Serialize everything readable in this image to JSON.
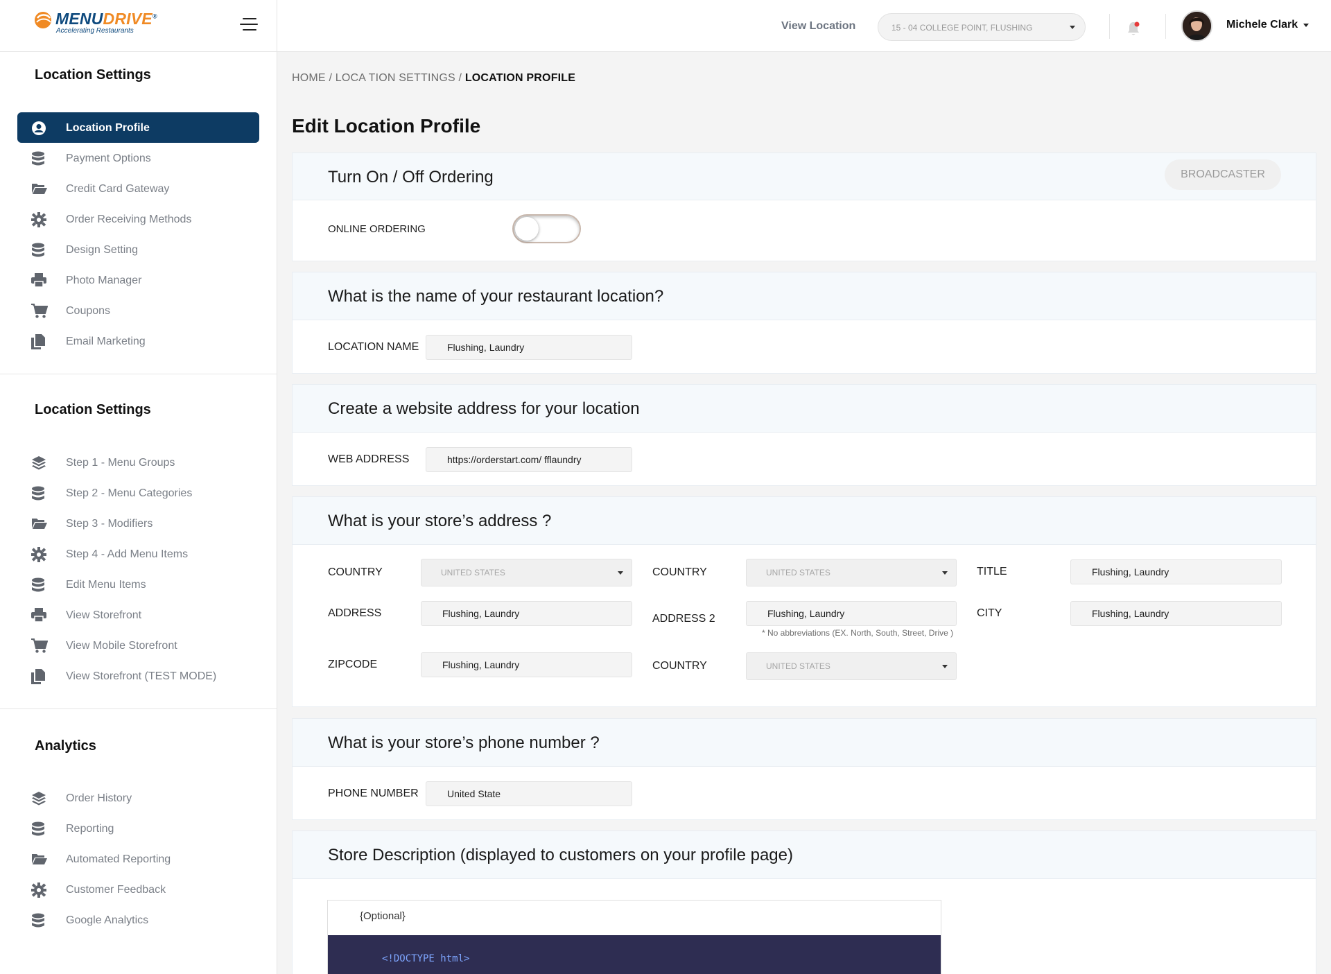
{
  "brand": {
    "name_part1": "MENU",
    "name_part2": "DRIVE",
    "registered": "®",
    "tagline": "Accelerating Restaurants"
  },
  "header": {
    "view_location_label": "View Location",
    "location_select_value": "15 - 04 COLLEGE POINT, FLUSHING",
    "user_name": "Michele Clark"
  },
  "sidebar": {
    "section1_title": "Location Settings",
    "section1_items": [
      {
        "label": "Location Profile",
        "icon": "user-circle-icon",
        "active": true
      },
      {
        "label": "Payment Options",
        "icon": "database-icon"
      },
      {
        "label": "Credit Card Gateway",
        "icon": "folder-open-icon"
      },
      {
        "label": "Order Receiving Methods",
        "icon": "gear-icon"
      },
      {
        "label": "Design Setting",
        "icon": "database-icon"
      },
      {
        "label": "Photo Manager",
        "icon": "printer-icon"
      },
      {
        "label": "Coupons",
        "icon": "cart-icon"
      },
      {
        "label": "Email Marketing",
        "icon": "copy-icon"
      }
    ],
    "section2_title": "Location Settings",
    "section2_items": [
      {
        "label": "Step 1 - Menu Groups",
        "icon": "layers-icon"
      },
      {
        "label": "Step 2 - Menu Categories",
        "icon": "database-icon"
      },
      {
        "label": "Step 3 - Modifiers",
        "icon": "folder-open-icon"
      },
      {
        "label": "Step 4 - Add Menu Items",
        "icon": "gear-icon"
      },
      {
        "label": "Edit Menu Items",
        "icon": "database-icon"
      },
      {
        "label": "View Storefront",
        "icon": "printer-icon"
      },
      {
        "label": "View Mobile Storefront",
        "icon": "cart-icon"
      },
      {
        "label": "View Storefront (TEST MODE)",
        "icon": "copy-icon"
      }
    ],
    "section3_title": "Analytics",
    "section3_items": [
      {
        "label": "Order History",
        "icon": "layers-icon"
      },
      {
        "label": "Reporting",
        "icon": "database-icon"
      },
      {
        "label": "Automated Reporting",
        "icon": "folder-open-icon"
      },
      {
        "label": "Customer Feedback",
        "icon": "gear-icon"
      },
      {
        "label": "Google Analytics",
        "icon": "database-icon"
      }
    ]
  },
  "breadcrumb": {
    "home": "HOME",
    "sep1": " / ",
    "location_settings": "LOCA TION SETTINGS",
    "sep2": " / ",
    "current": "LOCATION PROFILE"
  },
  "page_title": "Edit Location Profile",
  "ordering": {
    "heading": "Turn On / Off Ordering",
    "broadcaster_label": "BROADCASTER",
    "online_ordering_label": "ONLINE ORDERING",
    "online_ordering_on": false
  },
  "location_name": {
    "heading": "What is the name of your restaurant location?",
    "label": "LOCATION NAME",
    "value": "Flushing, Laundry"
  },
  "web_address": {
    "heading": "Create a website address for your location",
    "label": "WEB ADDRESS",
    "value": "https://orderstart.com/ fflaundry"
  },
  "address": {
    "heading": "What is your store’s address ?",
    "country1_label": "COUNTRY",
    "country1_value": "UNITED STATES",
    "country2_label": "COUNTRY",
    "country2_value": "UNITED STATES",
    "title_label": "TITLE",
    "title_value": "Flushing, Laundry",
    "address_label": "ADDRESS",
    "address_value": "Flushing, Laundry",
    "address2_label": "ADDRESS 2",
    "address2_value": "Flushing, Laundry",
    "address2_hint": "* No abbreviations (EX. North, South, Street, Drive )",
    "city_label": "CITY",
    "city_value": "Flushing, Laundry",
    "zipcode_label": "ZIPCODE",
    "zipcode_value": "Flushing, Laundry",
    "country3_label": "COUNTRY",
    "country3_value": "UNITED STATES"
  },
  "phone": {
    "heading": "What is your store’s phone number ?",
    "label": "PHONE NUMBER",
    "value": "United State"
  },
  "description": {
    "heading": "Store Description (displayed to customers on your profile page)",
    "placeholder": "{Optional}",
    "code_line1": "<!DOCTYPE html>"
  },
  "colors": {
    "sidebar_active": "#0d3b63",
    "brand_blue": "#0f4a7e",
    "brand_orange": "#f08a24",
    "editor_bg": "#2e2d52"
  }
}
